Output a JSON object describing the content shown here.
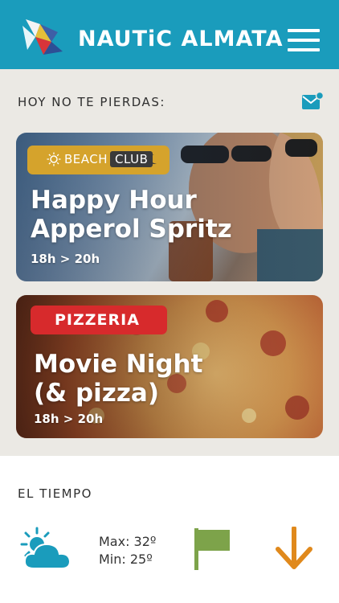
{
  "header": {
    "brand": "NAUTiC ALMATA",
    "menu_icon": "hamburger-menu-icon",
    "bg_color": "#1a9cbc"
  },
  "highlights": {
    "title": "HOY NO TE PIERDAS:",
    "mail_icon": "mail-notification-icon",
    "cards": [
      {
        "badge_left": "BEACH",
        "badge_right": "CLUB",
        "badge_color": "#d5a32c",
        "title_line1": "Happy Hour",
        "title_line2": "Apperol Spritz",
        "time": "18h > 20h"
      },
      {
        "badge": "PIZZERIA",
        "badge_color": "#d72a2c",
        "title_line1": "Movie Night",
        "title_line2": "(& pizza)",
        "time": "18h > 20h"
      }
    ]
  },
  "weather": {
    "title": "EL TIEMPO",
    "icon": "partly-cloudy-icon",
    "max": "Max: 32º",
    "min": "Min: 25º",
    "flag_icon": "green-flag-icon",
    "flag_color": "#7da34a",
    "wind_icon": "arrow-down-icon",
    "wind_color": "#e0891c"
  }
}
